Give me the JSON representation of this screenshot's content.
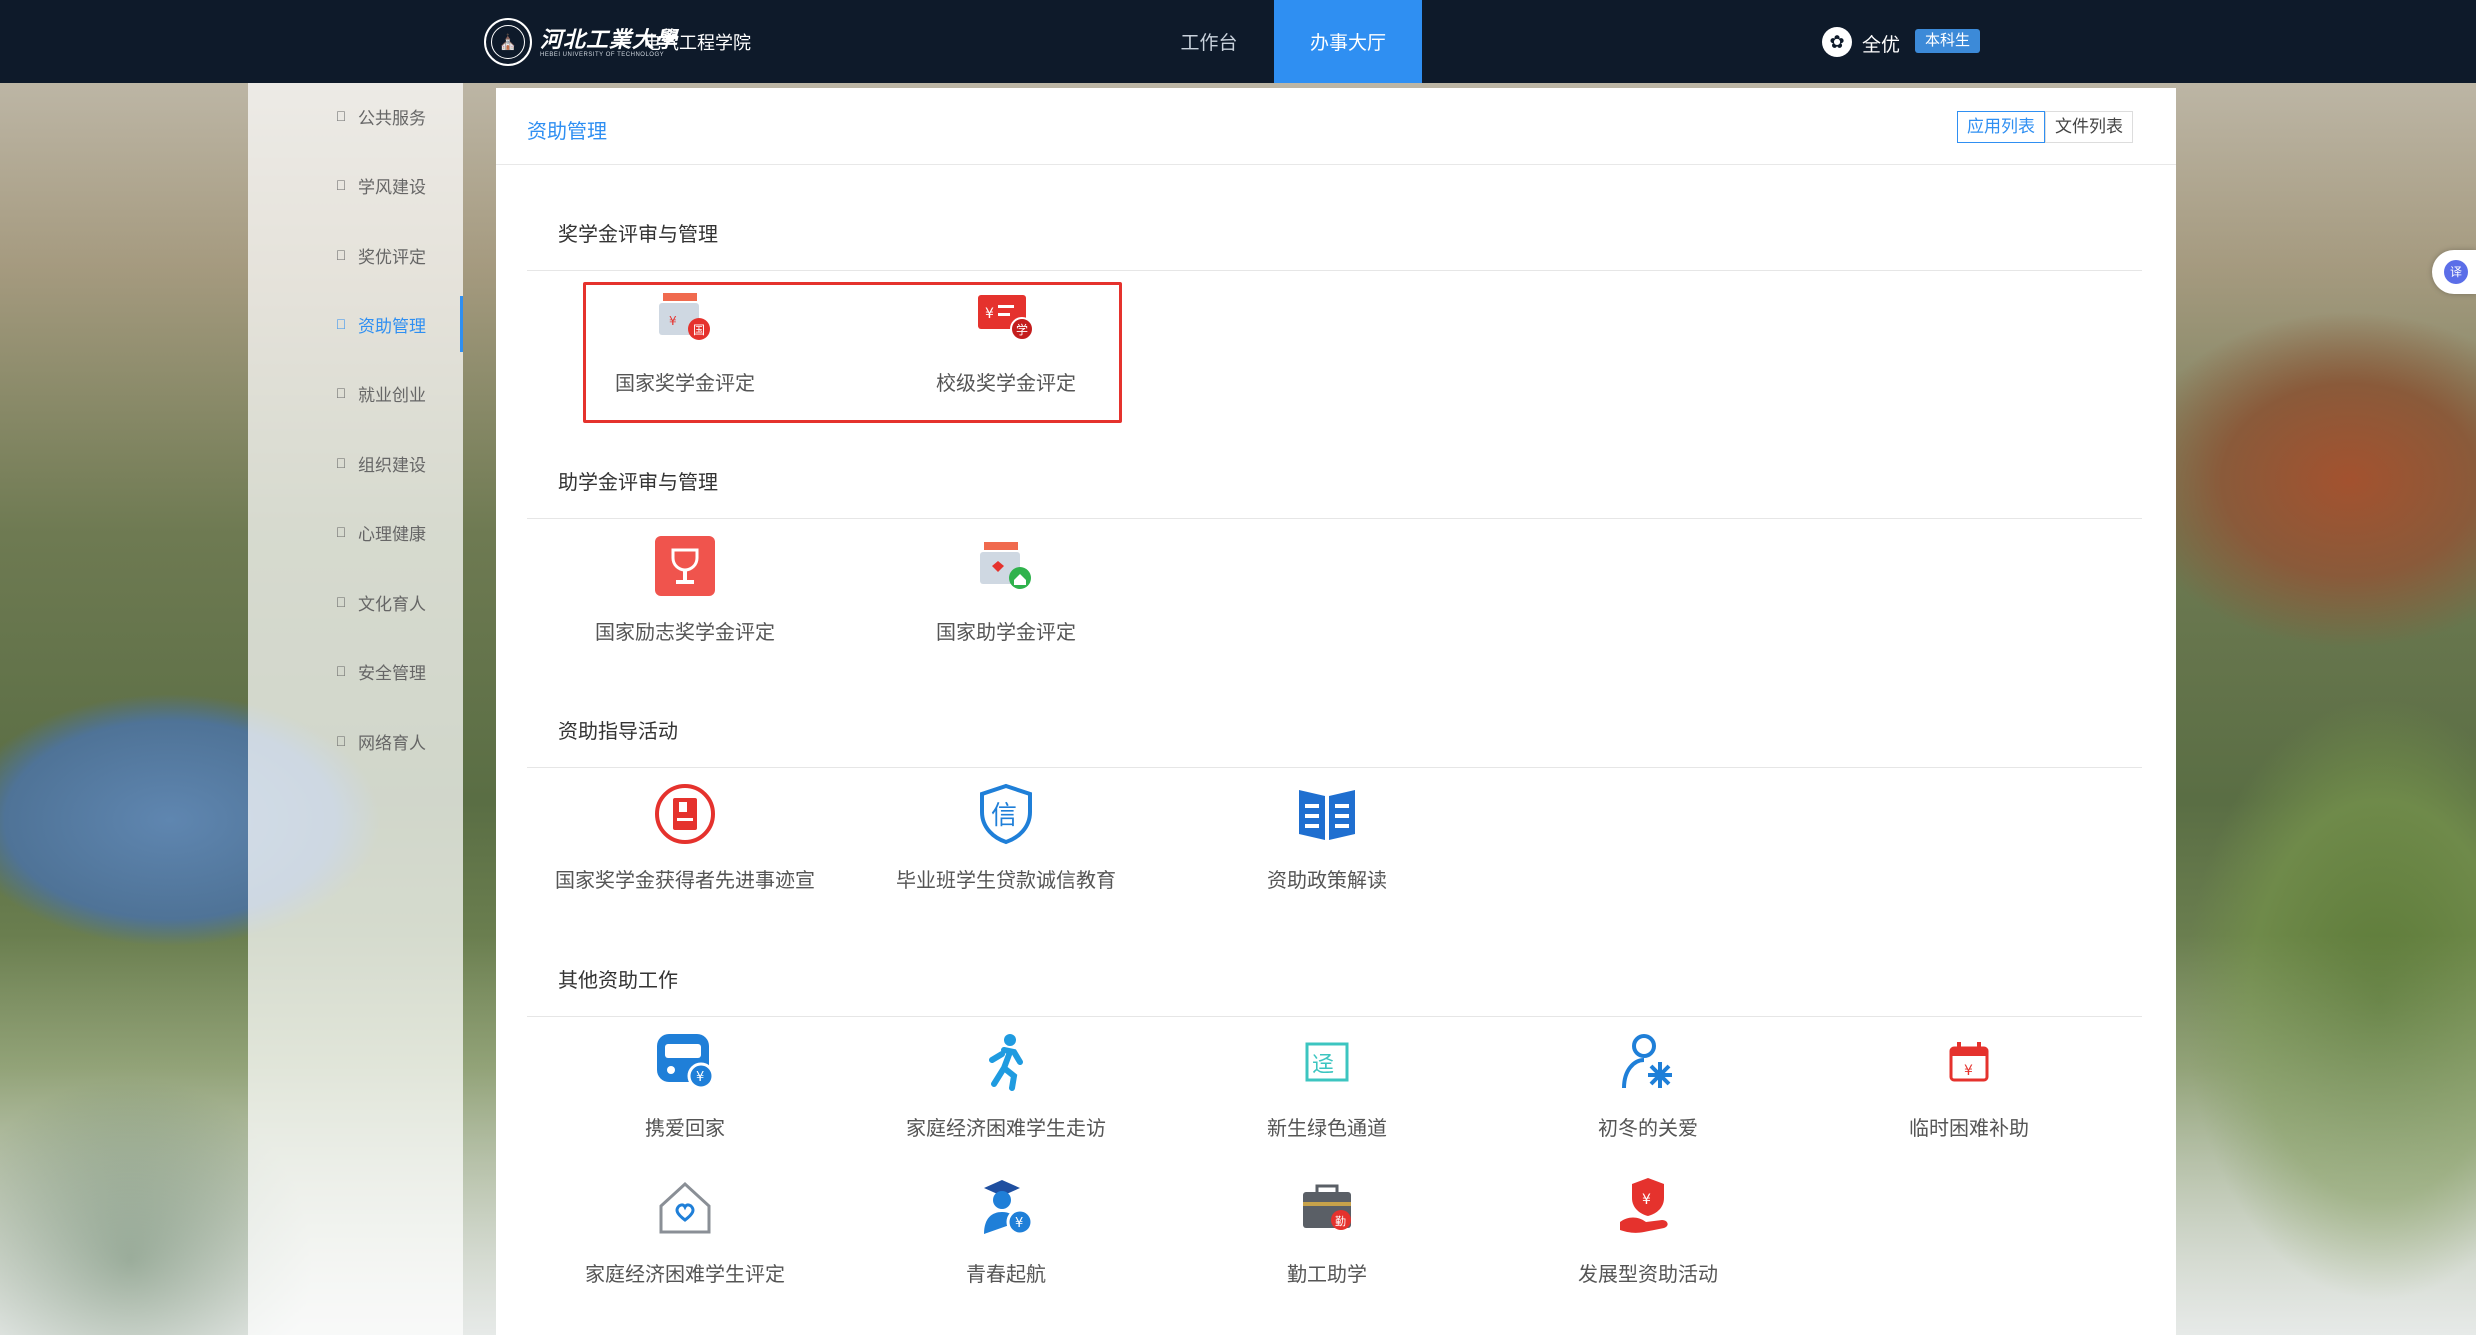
{
  "header": {
    "university_name": "河北工業大學",
    "university_en": "HEBEI UNIVERSITY OF TECHNOLOGY",
    "college": "电气工程学院",
    "nav": [
      {
        "label": "工作台",
        "active": false
      },
      {
        "label": "办事大厅",
        "active": true
      }
    ],
    "user": {
      "name": "全优",
      "role": "本科生"
    }
  },
  "sidebar": {
    "items": [
      {
        "label": "公共服务",
        "active": false
      },
      {
        "label": "学风建设",
        "active": false
      },
      {
        "label": "奖优评定",
        "active": false
      },
      {
        "label": "资助管理",
        "active": true
      },
      {
        "label": "就业创业",
        "active": false
      },
      {
        "label": "组织建设",
        "active": false
      },
      {
        "label": "心理健康",
        "active": false
      },
      {
        "label": "文化育人",
        "active": false
      },
      {
        "label": "安全管理",
        "active": false
      },
      {
        "label": "网络育人",
        "active": false
      }
    ]
  },
  "main": {
    "title": "资助管理",
    "view_toggle": [
      "应用列表",
      "文件列表"
    ],
    "active_view": "应用列表",
    "sections": [
      {
        "title": "奖学金评审与管理",
        "items": [
          {
            "label": "国家奖学金评定",
            "icon": "national-scholarship-icon"
          },
          {
            "label": "校级奖学金评定",
            "icon": "school-scholarship-icon"
          }
        ]
      },
      {
        "title": "助学金评审与管理",
        "items": [
          {
            "label": "国家励志奖学金评定",
            "icon": "trophy-icon"
          },
          {
            "label": "国家助学金评定",
            "icon": "grant-envelope-icon"
          }
        ]
      },
      {
        "title": "资助指导活动",
        "items": [
          {
            "label": "国家奖学金获得者先进事迹宣",
            "icon": "bookmark-badge-icon"
          },
          {
            "label": "毕业班学生贷款诚信教育",
            "icon": "shield-trust-icon"
          },
          {
            "label": "资助政策解读",
            "icon": "open-book-icon"
          }
        ]
      },
      {
        "title": "其他资助工作",
        "items": [
          {
            "label": "携爱回家",
            "icon": "train-icon"
          },
          {
            "label": "家庭经济困难学生走访",
            "icon": "walking-person-icon"
          },
          {
            "label": "新生绿色通道",
            "icon": "green-channel-icon"
          },
          {
            "label": "初冬的关爱",
            "icon": "snowflake-person-icon"
          },
          {
            "label": "临时困难补助",
            "icon": "calendar-yuan-icon"
          },
          {
            "label": "家庭经济困难学生评定",
            "icon": "house-heart-icon"
          },
          {
            "label": "青春起航",
            "icon": "graduate-yuan-icon"
          },
          {
            "label": "勤工助学",
            "icon": "briefcase-icon"
          },
          {
            "label": "发展型资助活动",
            "icon": "hand-shield-yuan-icon"
          }
        ]
      }
    ]
  },
  "colors": {
    "topbar": "#0e1a2a",
    "accent": "#2f8ff2",
    "highlight_box": "#e5322d",
    "icon_red": "#e5322d",
    "icon_blue": "#1f7fd8",
    "icon_teal": "#3cc5c0"
  }
}
